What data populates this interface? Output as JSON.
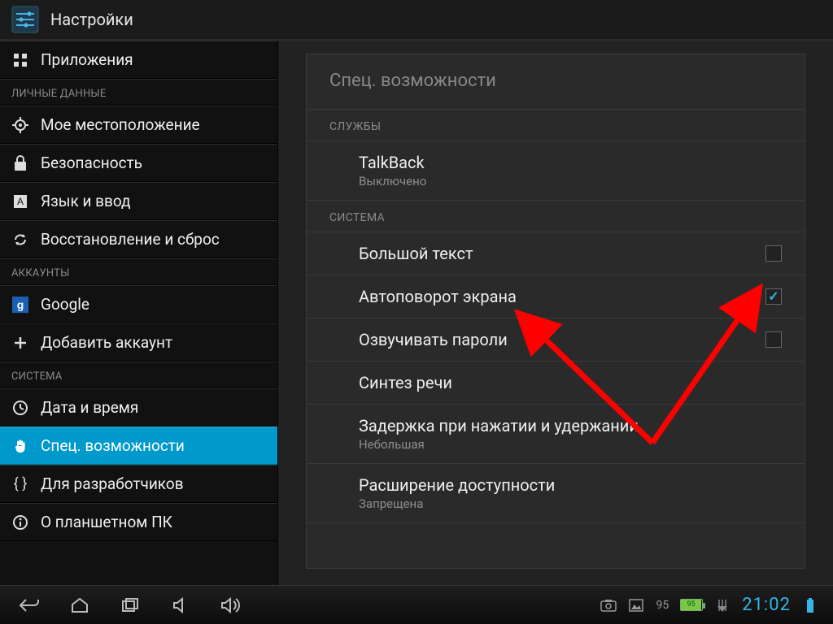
{
  "header": {
    "title": "Настройки"
  },
  "sidebar": {
    "top_items": [
      {
        "label": "Приложения",
        "icon": "apps"
      }
    ],
    "groups": [
      {
        "title": "ЛИЧНЫЕ ДАННЫЕ",
        "items": [
          {
            "label": "Мое местоположение",
            "icon": "target"
          },
          {
            "label": "Безопасность",
            "icon": "lock"
          },
          {
            "label": "Язык и ввод",
            "icon": "lang"
          },
          {
            "label": "Восстановление и сброс",
            "icon": "sync"
          }
        ]
      },
      {
        "title": "АККАУНТЫ",
        "items": [
          {
            "label": "Google",
            "icon": "google"
          },
          {
            "label": "Добавить аккаунт",
            "icon": "plus"
          }
        ]
      },
      {
        "title": "СИСТЕМА",
        "items": [
          {
            "label": "Дата и время",
            "icon": "clock"
          },
          {
            "label": "Спец. возможности",
            "icon": "hand",
            "selected": true
          },
          {
            "label": "Для разработчиков",
            "icon": "braces"
          },
          {
            "label": "О планшетном ПК",
            "icon": "info"
          }
        ]
      }
    ]
  },
  "panel": {
    "title": "Спец. возможности",
    "sections": [
      {
        "title": "СЛУЖБЫ",
        "rows": [
          {
            "label": "TalkBack",
            "sub": "Выключено"
          }
        ]
      },
      {
        "title": "СИСТЕМА",
        "rows": [
          {
            "label": "Большой текст",
            "checkbox": true,
            "checked": false
          },
          {
            "label": "Автоповорот экрана",
            "checkbox": true,
            "checked": true
          },
          {
            "label": "Озвучивать пароли",
            "checkbox": true,
            "checked": false
          },
          {
            "label": "Синтез речи"
          },
          {
            "label": "Задержка при нажатии и удержании",
            "sub": "Небольшая"
          },
          {
            "label": "Расширение доступности",
            "sub": "Запрещена"
          }
        ]
      }
    ]
  },
  "navbar": {
    "battery_pct": "95",
    "clock": "21:02"
  }
}
